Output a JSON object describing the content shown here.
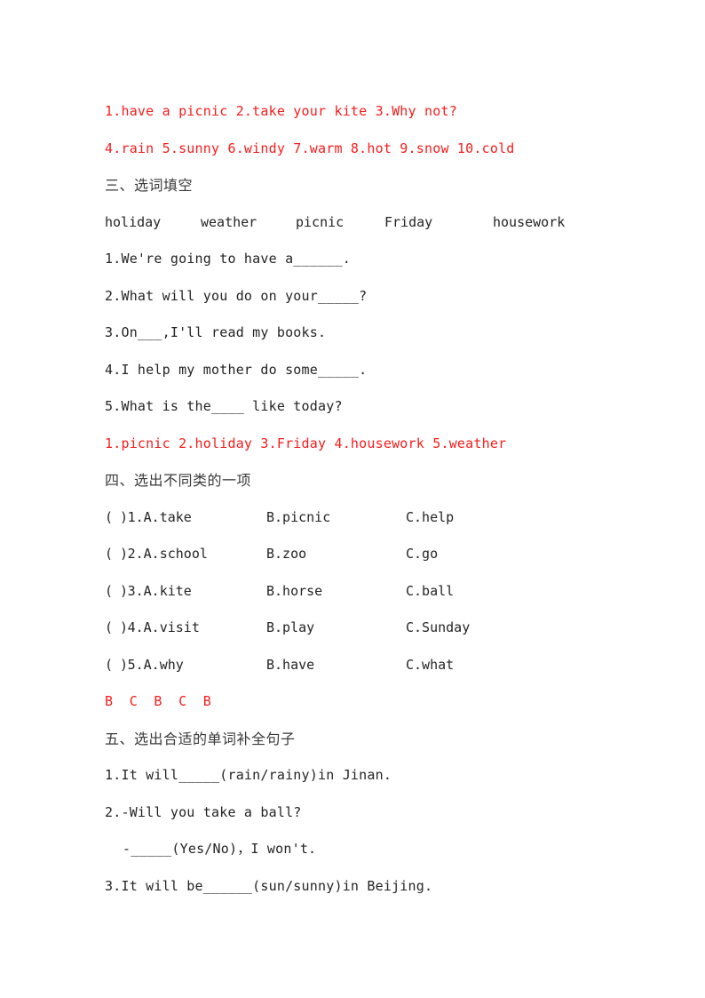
{
  "document": {
    "paper": "A4",
    "text_color": "#242424",
    "answer_color": "#f71c1c",
    "heading_color": "#3a3a3a"
  },
  "answers_top": {
    "line1": "1.have a picnic 2.take your kite 3.Why not?",
    "line2": "4.rain 5.sunny 6.windy 7.warm 8.hot 9.snow 10.cold"
  },
  "section_three": {
    "heading": "三、选词填空",
    "word_bank": [
      "holiday",
      "weather",
      "picnic",
      "Friday",
      "housework"
    ],
    "questions": [
      "1.We're going to have a______.",
      "2.What will you do on your_____?",
      "3.On___,I'll read my books.",
      "4.I help my mother do some_____.",
      "5.What is the____ like today?"
    ],
    "answers": "1.picnic 2.holiday 3.Friday 4.housework 5.weather"
  },
  "section_four": {
    "heading": "四、选出不同类的一项",
    "rows": [
      {
        "paren": "( )",
        "number": "1.",
        "a": "A.take",
        "b": "B.picnic",
        "c": "C.help"
      },
      {
        "paren": "( )",
        "number": "2.",
        "a": "A.school",
        "b": "B.zoo",
        "c": "C.go"
      },
      {
        "paren": "( )",
        "number": "3.",
        "a": "A.kite",
        "b": "B.horse",
        "c": "C.ball"
      },
      {
        "paren": "( )",
        "number": "4.",
        "a": "A.visit",
        "b": "B.play",
        "c": "C.Sunday"
      },
      {
        "paren": "( )",
        "number": "5.",
        "a": "A.why",
        "b": "B.have",
        "c": "C.what"
      }
    ],
    "answers": "B  C  B  C  B"
  },
  "section_five": {
    "heading": "五、选出合适的单词补全句子",
    "questions": [
      "1.It will_____(rain/rainy)in Jinan.",
      "2.-Will you take a ball?",
      "-_____(Yes/No)，I won't.",
      "3.It will be______(sun/sunny)in Beijing."
    ]
  }
}
